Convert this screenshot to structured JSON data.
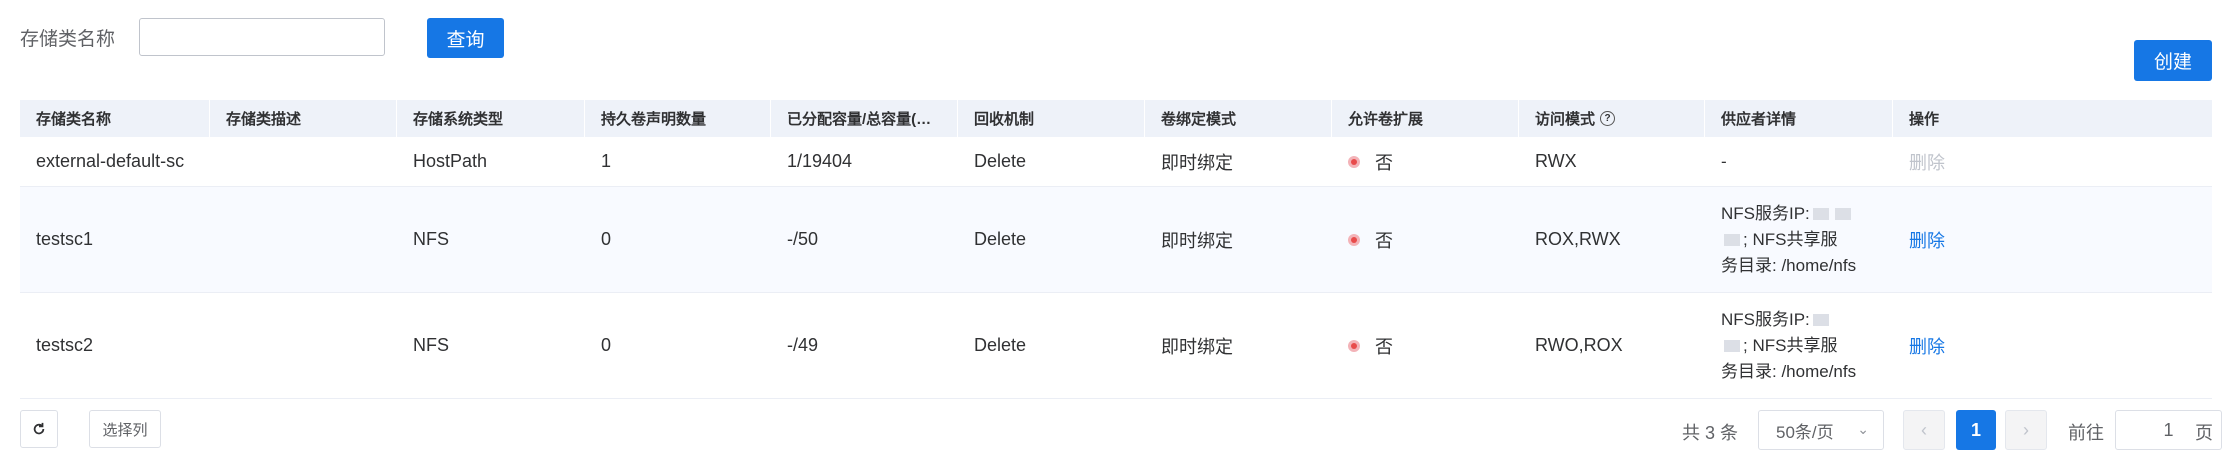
{
  "filter": {
    "label": "存储类名称",
    "value": "",
    "search_label": "查询"
  },
  "create_label": "创建",
  "table": {
    "headers": [
      "存储类名称",
      "存储类描述",
      "存储系统类型",
      "持久卷声明数量",
      "已分配容量/总容量(…",
      "回收机制",
      "卷绑定模式",
      "允许卷扩展",
      "访问模式",
      "供应者详情",
      "操作"
    ],
    "rows": [
      {
        "name": "external-default-sc",
        "desc": "",
        "type": "HostPath",
        "pvc": "1",
        "capacity": "1/19404",
        "reclaim": "Delete",
        "binding": "即时绑定",
        "expand": "否",
        "access": "RWX",
        "provider_l1": "-",
        "provider_l2": "",
        "provider_l3": "",
        "action": "删除"
      },
      {
        "name": "testsc1",
        "desc": "",
        "type": "NFS",
        "pvc": "0",
        "capacity": "-/50",
        "reclaim": "Delete",
        "binding": "即时绑定",
        "expand": "否",
        "access": "ROX,RWX",
        "provider_l1": "NFS服务IP:",
        "provider_l2": "; NFS共享服",
        "provider_l3": "务目录: /home/nfs",
        "action": "删除"
      },
      {
        "name": "testsc2",
        "desc": "",
        "type": "NFS",
        "pvc": "0",
        "capacity": "-/49",
        "reclaim": "Delete",
        "binding": "即时绑定",
        "expand": "否",
        "access": "RWO,ROX",
        "provider_l1": "NFS服务IP:",
        "provider_l2": "; NFS共享服",
        "provider_l3": "务目录: /home/nfs",
        "action": "删除"
      }
    ]
  },
  "footer": {
    "select_columns": "选择列",
    "total": "共 3 条",
    "page_size": "50条/页",
    "current_page": "1",
    "goto_label": "前往",
    "goto_value": "1",
    "goto_suffix": "页"
  },
  "colors": {
    "primary": "#1677e5",
    "header_bg": "#eef2f9",
    "status_red": "#e84b4b"
  }
}
